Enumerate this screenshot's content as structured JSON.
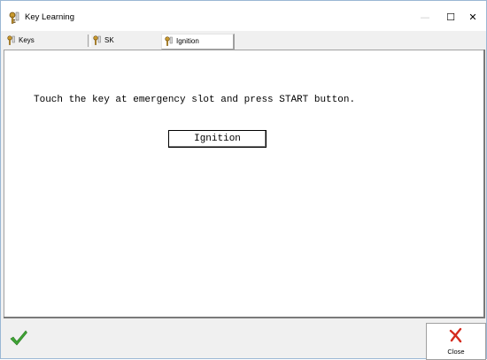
{
  "window": {
    "title": "Key Learning",
    "icon": "key-icon",
    "controls": {
      "minimize": "—",
      "maximize": "☐",
      "close": "✕"
    }
  },
  "tabs": [
    {
      "label": "Keys",
      "icon": "key-icon",
      "active": false
    },
    {
      "label": "SK",
      "icon": "key-icon",
      "active": false
    },
    {
      "label": "Ignition",
      "icon": "key-icon",
      "active": true
    }
  ],
  "main": {
    "instruction": "Touch the key at emergency slot and press START button.",
    "ignition_button_label": "Ignition"
  },
  "footer": {
    "confirm_icon": "check-icon",
    "close_label": "Close",
    "close_icon": "close-x-icon"
  },
  "colors": {
    "confirm_green": "#3fa535",
    "close_red": "#d52b1e",
    "key_gold": "#c99a2e"
  }
}
